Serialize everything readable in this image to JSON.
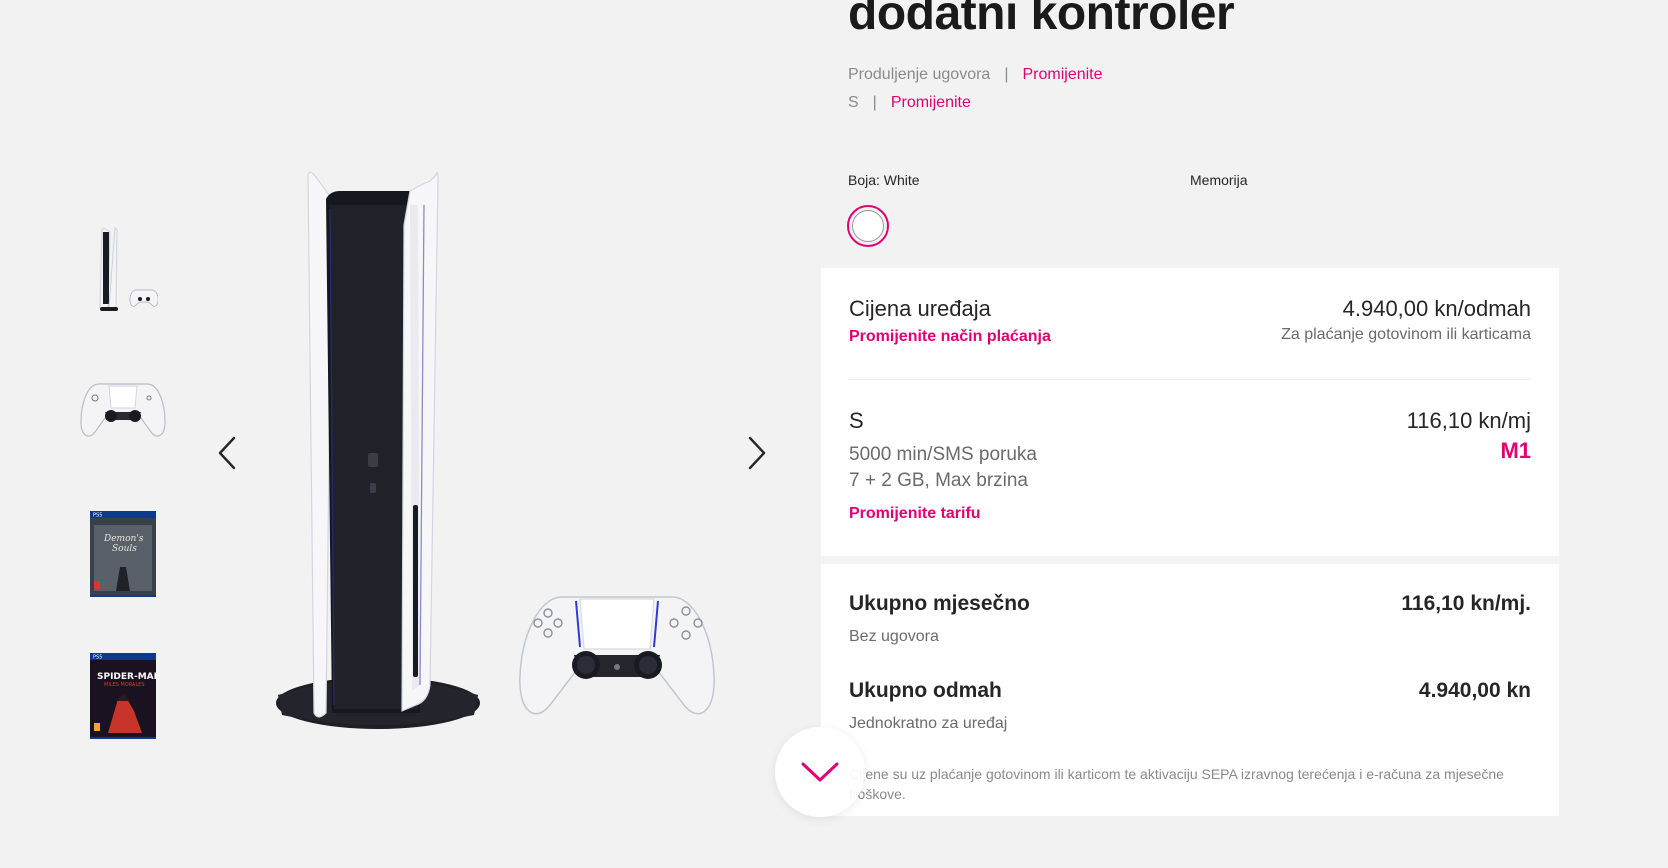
{
  "product": {
    "title": "dodatni kontroler",
    "contract_label": "Produljenje ugovora",
    "tariff_short": "S",
    "change_label": "Promijenite",
    "separator": "|"
  },
  "options": {
    "color_label": "Boja: White",
    "memory_label": "Memorija",
    "selected_color": "#ffffff"
  },
  "gallery": {
    "thumbnails": [
      "ps5-console-thumbnail",
      "dualsense-controller-thumbnail",
      "demons-souls-game-thumbnail",
      "spider-man-miles-morales-game-thumbnail"
    ]
  },
  "price": {
    "device_label": "Cijena uređaja",
    "change_payment": "Promijenite način plaćanja",
    "device_value": "4.940,00 kn/odmah",
    "payment_note": "Za plaćanje gotovinom ili karticama"
  },
  "plan": {
    "name": "S",
    "detail1": "5000 min/SMS poruka",
    "detail2": "7 + 2 GB, Max brzina",
    "change_tariff": "Promijenite tarifu",
    "price": "116,10 kn/mj",
    "code": "M1"
  },
  "totals": {
    "monthly_label": "Ukupno mjesečno",
    "monthly_sub": "Bez ugovora",
    "monthly_value": "116,10 kn/mj.",
    "now_label": "Ukupno odmah",
    "now_sub": "Jednokratno za uređaj",
    "now_value": "4.940,00 kn",
    "disclaimer": "Cijene su uz plaćanje gotovinom ili karticom te aktivaciju SEPA izravnog terećenja i e-računa za mjesečne troškove."
  },
  "colors": {
    "accent": "#e20074",
    "page_bg": "#f2f2f2",
    "card_bg": "#ffffff"
  }
}
